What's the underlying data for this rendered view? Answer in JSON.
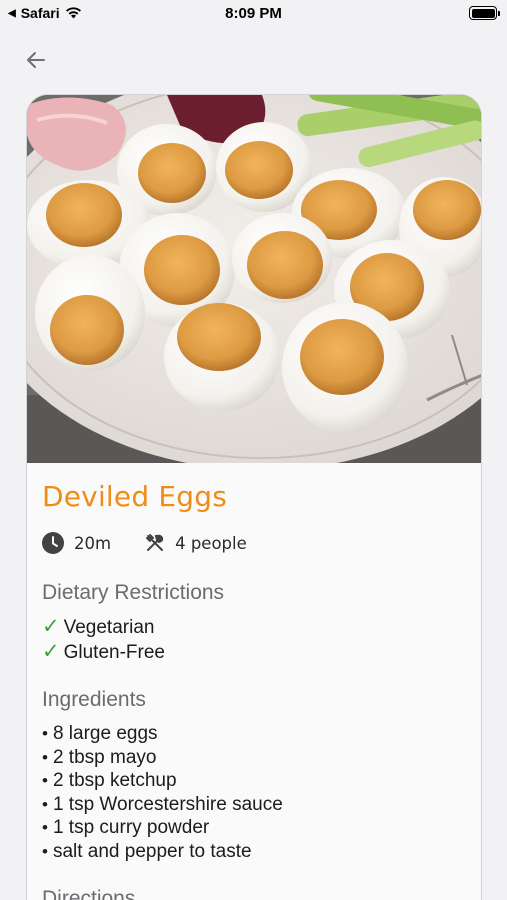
{
  "status_bar": {
    "app_name": "Safari",
    "time": "8:09 PM"
  },
  "nav": {
    "back_icon": "arrow-left-icon"
  },
  "recipe": {
    "title": "Deviled Eggs",
    "time": "20m",
    "servings": "4 people",
    "dietary_heading": "Dietary Restrictions",
    "dietary": [
      "Vegetarian",
      "Gluten-Free"
    ],
    "ingredients_heading": "Ingredients",
    "ingredients": [
      "8 large eggs",
      "2 tbsp mayo",
      "2 tbsp ketchup",
      "1 tsp Worcestershire sauce",
      "1 tsp curry powder",
      "salt and pepper to taste"
    ],
    "directions_heading": "Directions"
  },
  "colors": {
    "title": "#ef8d17",
    "check": "#3fa43f",
    "heading": "#6b6b70",
    "background": "#f2f2f4"
  }
}
